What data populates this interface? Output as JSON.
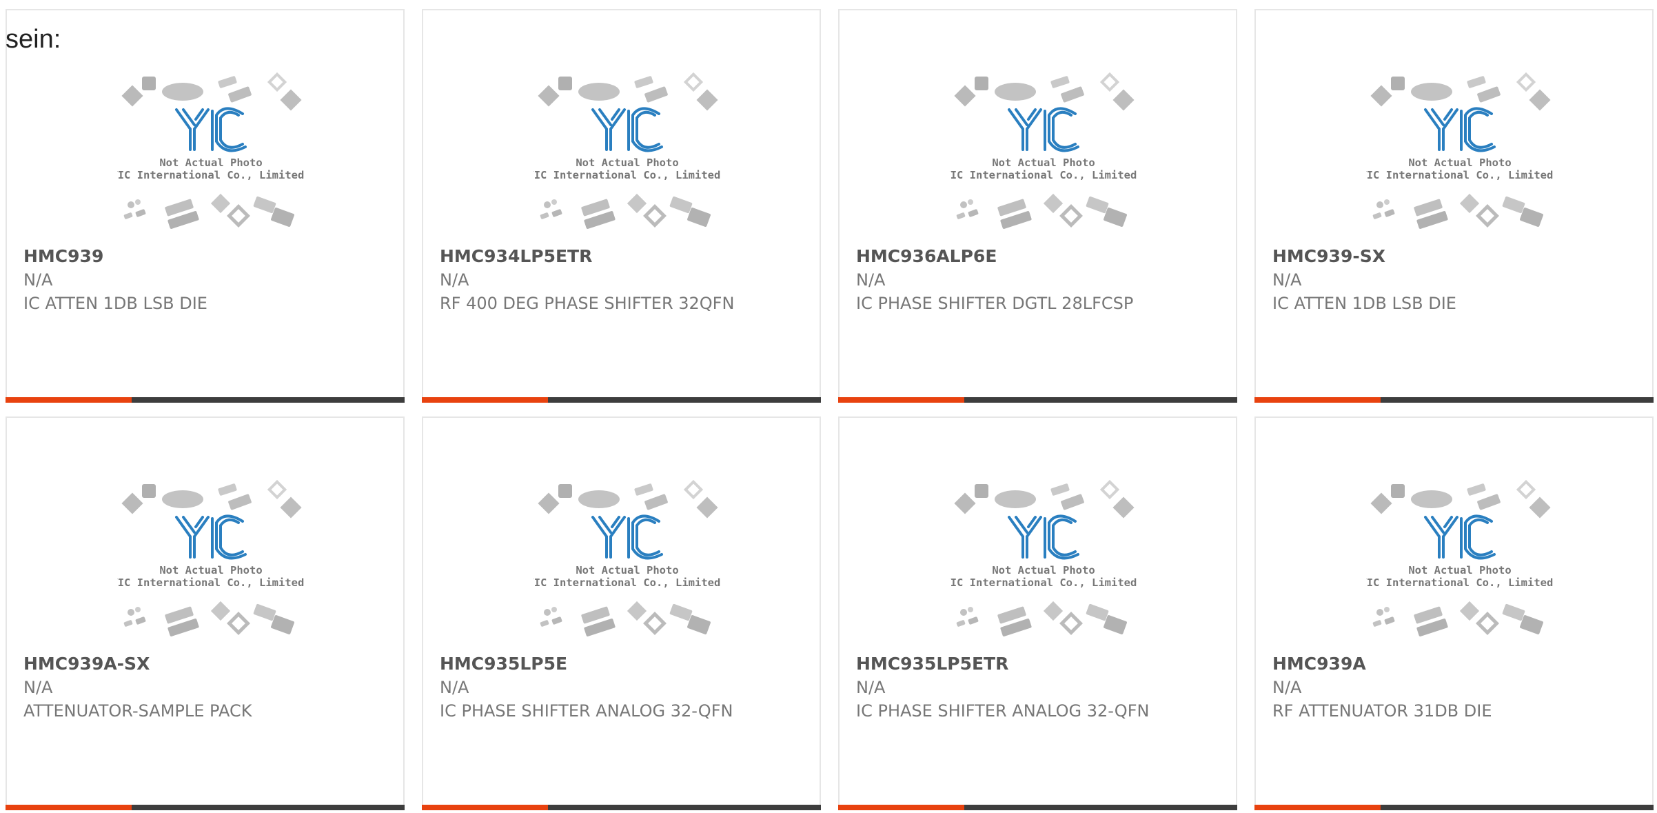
{
  "lead_text": "sein:",
  "placeholder_image": {
    "line1": "Not Actual Photo",
    "line2": "YIC International Co., Limited.",
    "logo_text": "YIC"
  },
  "colors": {
    "accent": "#e8420f",
    "bar": "#3d3d3d",
    "logo_blue": "#2a7fc0"
  },
  "products": [
    {
      "part": "HMC939",
      "manufacturer": "N/A",
      "description": "IC ATTEN 1DB LSB DIE"
    },
    {
      "part": "HMC934LP5ETR",
      "manufacturer": "N/A",
      "description": "RF 400 DEG PHASE SHIFTER 32QFN"
    },
    {
      "part": "HMC936ALP6E",
      "manufacturer": "N/A",
      "description": "IC PHASE SHIFTER DGTL 28LFCSP"
    },
    {
      "part": "HMC939-SX",
      "manufacturer": "N/A",
      "description": "IC ATTEN 1DB LSB DIE"
    },
    {
      "part": "HMC939A-SX",
      "manufacturer": "N/A",
      "description": "ATTENUATOR-SAMPLE PACK"
    },
    {
      "part": "HMC935LP5E",
      "manufacturer": "N/A",
      "description": "IC PHASE SHIFTER ANALOG 32-QFN"
    },
    {
      "part": "HMC935LP5ETR",
      "manufacturer": "N/A",
      "description": "IC PHASE SHIFTER ANALOG 32-QFN"
    },
    {
      "part": "HMC939A",
      "manufacturer": "N/A",
      "description": "RF ATTENUATOR 31DB DIE"
    }
  ]
}
